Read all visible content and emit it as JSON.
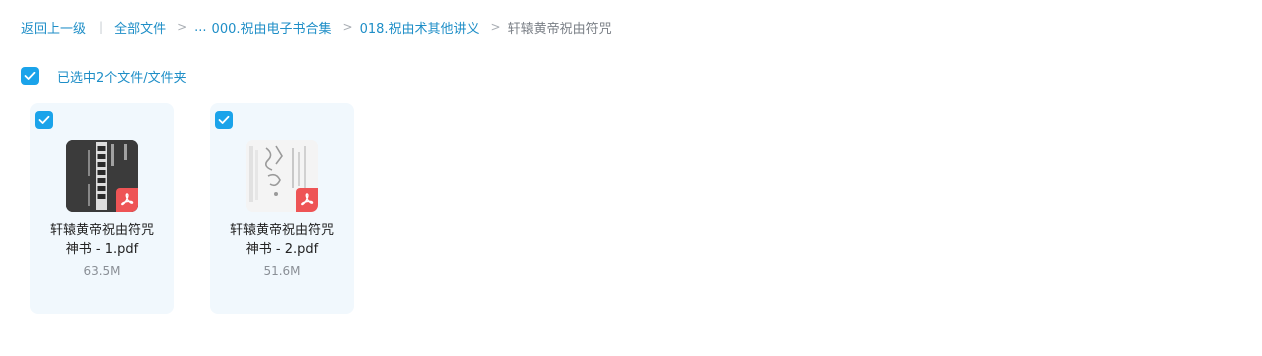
{
  "breadcrumb": {
    "back": "返回上一级",
    "root": "全部文件",
    "ellipsis": "...",
    "folder1": "000.祝由电子书合集",
    "folder2": "018.祝由术其他讲义",
    "current": "轩辕黄帝祝由符咒"
  },
  "selection": {
    "label": "已选中2个文件/文件夹"
  },
  "files": [
    {
      "name_line1": "轩辕黄帝祝由符咒",
      "name_line2": "神书 - 1.pdf",
      "size": "63.5M",
      "type_icon": "pdf-icon"
    },
    {
      "name_line1": "轩辕黄帝祝由符咒",
      "name_line2": "神书 - 2.pdf",
      "size": "51.6M",
      "type_icon": "pdf-icon"
    }
  ],
  "colors": {
    "accent": "#1aa3ea",
    "link": "#1e8ec7",
    "card_bg": "#f1f8fd",
    "pdf_badge": "#ee5455"
  }
}
